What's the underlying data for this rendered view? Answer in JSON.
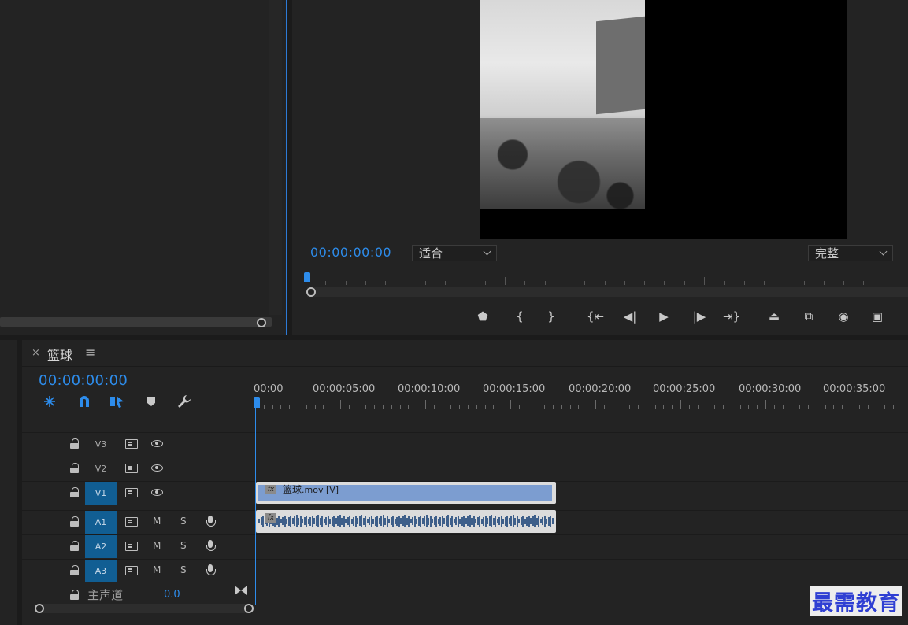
{
  "monitor": {
    "timecode": "00:00:00:00",
    "fit_dropdown": "适合",
    "quality_dropdown": "完整",
    "controls": [
      {
        "name": "add-marker-button",
        "glyph": "⬟"
      },
      {
        "name": "mark-in-button",
        "glyph": "{"
      },
      {
        "name": "mark-out-button",
        "glyph": "}"
      },
      {
        "name": "go-to-in-button",
        "glyph": "{⇤"
      },
      {
        "name": "step-back-button",
        "glyph": "◀|"
      },
      {
        "name": "play-button",
        "glyph": "▶"
      },
      {
        "name": "step-forward-button",
        "glyph": "|▶"
      },
      {
        "name": "go-to-out-button",
        "glyph": "⇥}"
      },
      {
        "name": "lift-button",
        "glyph": "⏏"
      },
      {
        "name": "extract-button",
        "glyph": "⧉"
      },
      {
        "name": "export-frame-button",
        "glyph": "◉"
      },
      {
        "name": "compare-view-button",
        "glyph": "▣"
      }
    ]
  },
  "timeline": {
    "close": "×",
    "sequence_name": "篮球",
    "menu": "≡",
    "timecode": "00:00:00:00",
    "ruler_labels": [
      "00:00",
      "00:00:05:00",
      "00:00:10:00",
      "00:00:15:00",
      "00:00:20:00",
      "00:00:25:00",
      "00:00:30:00",
      "00:00:35:00"
    ],
    "tools": [
      "nest-icon",
      "snap-icon",
      "linked-selection-icon",
      "add-marker-icon",
      "settings-wrench-icon"
    ],
    "video_tracks": [
      {
        "name": "V3",
        "selected": false
      },
      {
        "name": "V2",
        "selected": false
      },
      {
        "name": "V1",
        "selected": true
      }
    ],
    "audio_tracks": [
      {
        "name": "A1",
        "selected": true,
        "mute": "M",
        "solo": "S"
      },
      {
        "name": "A2",
        "selected": true,
        "mute": "M",
        "solo": "S"
      },
      {
        "name": "A3",
        "selected": true,
        "mute": "M",
        "solo": "S"
      }
    ],
    "master": {
      "label": "主声道",
      "value": "0.0"
    },
    "clip_v1": {
      "fx": "fx",
      "name": "篮球",
      "ext": ".mov [V]"
    },
    "clip_a1": {
      "fx": "fx"
    }
  },
  "watermark": "最需教育",
  "colors": {
    "accent": "#2d8ceb",
    "track_selected": "#115e93",
    "video_clip": "#7c9dd0",
    "panel_bg": "#232323"
  }
}
